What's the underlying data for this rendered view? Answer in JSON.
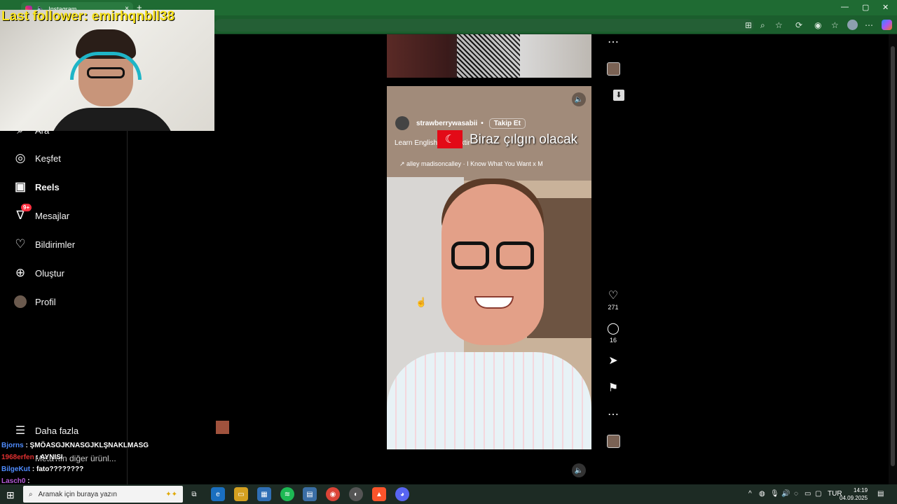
{
  "browser": {
    "tab_title": "Instagram",
    "new_tab": "+",
    "tab_close": "×",
    "win_min": "—",
    "win_max": "▢",
    "win_close": "✕"
  },
  "overlay": {
    "last_follower": "Last follower: emirhqnbll38"
  },
  "sidebar": {
    "partial_item": "Ara",
    "items": [
      {
        "label": "Keşfet",
        "icon": "compass-icon"
      },
      {
        "label": "Reels",
        "icon": "reels-icon"
      },
      {
        "label": "Mesajlar",
        "icon": "messages-icon",
        "badge": "9+"
      },
      {
        "label": "Bildirimler",
        "icon": "heart-icon"
      },
      {
        "label": "Oluştur",
        "icon": "plus-icon"
      },
      {
        "label": "Profil",
        "icon": "profile-avatar"
      }
    ],
    "more_label": "Daha fazla"
  },
  "reel": {
    "username": "strawberrywasabii",
    "separator": "•",
    "follow_label": "Takip Et",
    "caption": "Learn English #demektir",
    "overlay_text": "Biraz çılgın olacak",
    "audio": "↗ alley  madisoncalley · I Know What You Want x M",
    "likes": "271",
    "comments": "16"
  },
  "chat": [
    {
      "user": "Bjorns",
      "text": ": ŞMÖASGJKNASGJKLŞNAKLMASG"
    },
    {
      "user": "1968erfen",
      "text": ": AYNISI"
    },
    {
      "user": "BilgeKut",
      "text": ": fato????????"
    },
    {
      "user": "Lasch0",
      "text": ":"
    }
  ],
  "sidebar_under_chat": "Meta'nın diğer ürünl...",
  "taskbar": {
    "search_placeholder": "Aramak için buraya yazın",
    "lang": "TUR",
    "time": "14:19",
    "date": "04.09.2025"
  }
}
